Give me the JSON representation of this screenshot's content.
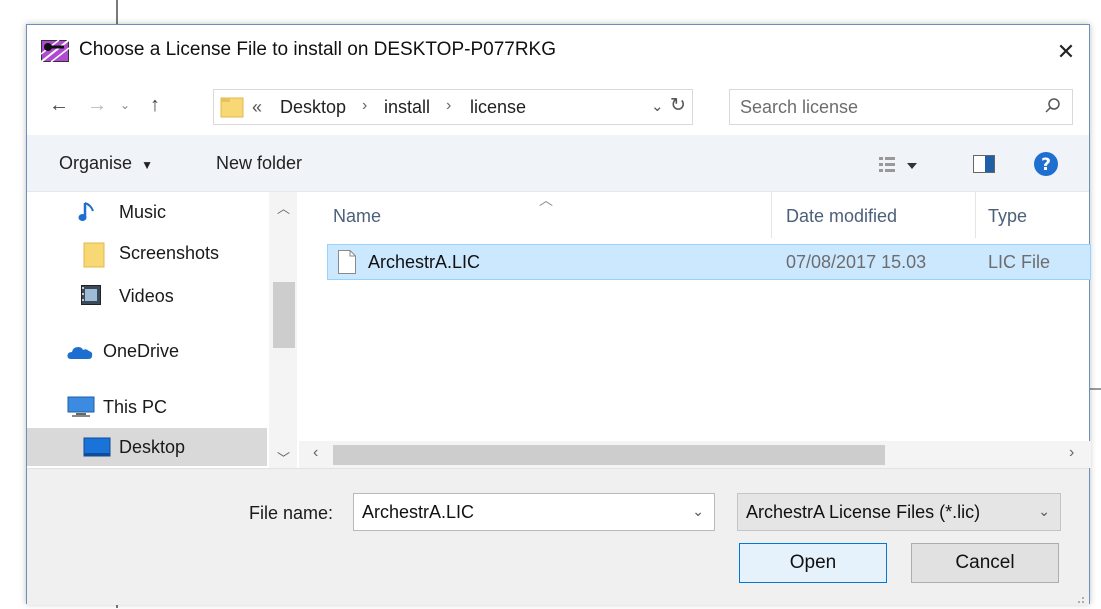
{
  "window": {
    "title": "Choose a License File to install on DESKTOP-P077RKG"
  },
  "address_bar": {
    "overflow": "«",
    "crumbs": [
      "Desktop",
      "install",
      "license"
    ],
    "separator": "›"
  },
  "search": {
    "placeholder": "Search license"
  },
  "toolbar": {
    "organise_label": "Organise",
    "new_folder_label": "New folder"
  },
  "sidebar": {
    "items": [
      {
        "label": "Music",
        "icon": "music-icon"
      },
      {
        "label": "Screenshots",
        "icon": "folder-icon"
      },
      {
        "label": "Videos",
        "icon": "video-icon"
      },
      {
        "label": "OneDrive",
        "icon": "onedrive-icon"
      },
      {
        "label": "This PC",
        "icon": "computer-icon"
      },
      {
        "label": "Desktop",
        "icon": "desktop-icon",
        "selected": true
      }
    ]
  },
  "file_list": {
    "columns": {
      "name": "Name",
      "date": "Date modified",
      "type": "Type"
    },
    "rows": [
      {
        "name": "ArchestrA.LIC",
        "date": "07/08/2017 15.03",
        "type": "LIC File",
        "selected": true
      }
    ]
  },
  "footer": {
    "file_name_label": "File name:",
    "file_name_value": "ArchestrA.LIC",
    "file_type_value": "ArchestrA License Files (*.lic)",
    "open_label": "Open",
    "cancel_label": "Cancel"
  },
  "colors": {
    "selection": "#cce8ff",
    "selection_border": "#99d1ff",
    "accent": "#0078d7",
    "folder": "#f8d775",
    "help": "#1f6fd1"
  }
}
